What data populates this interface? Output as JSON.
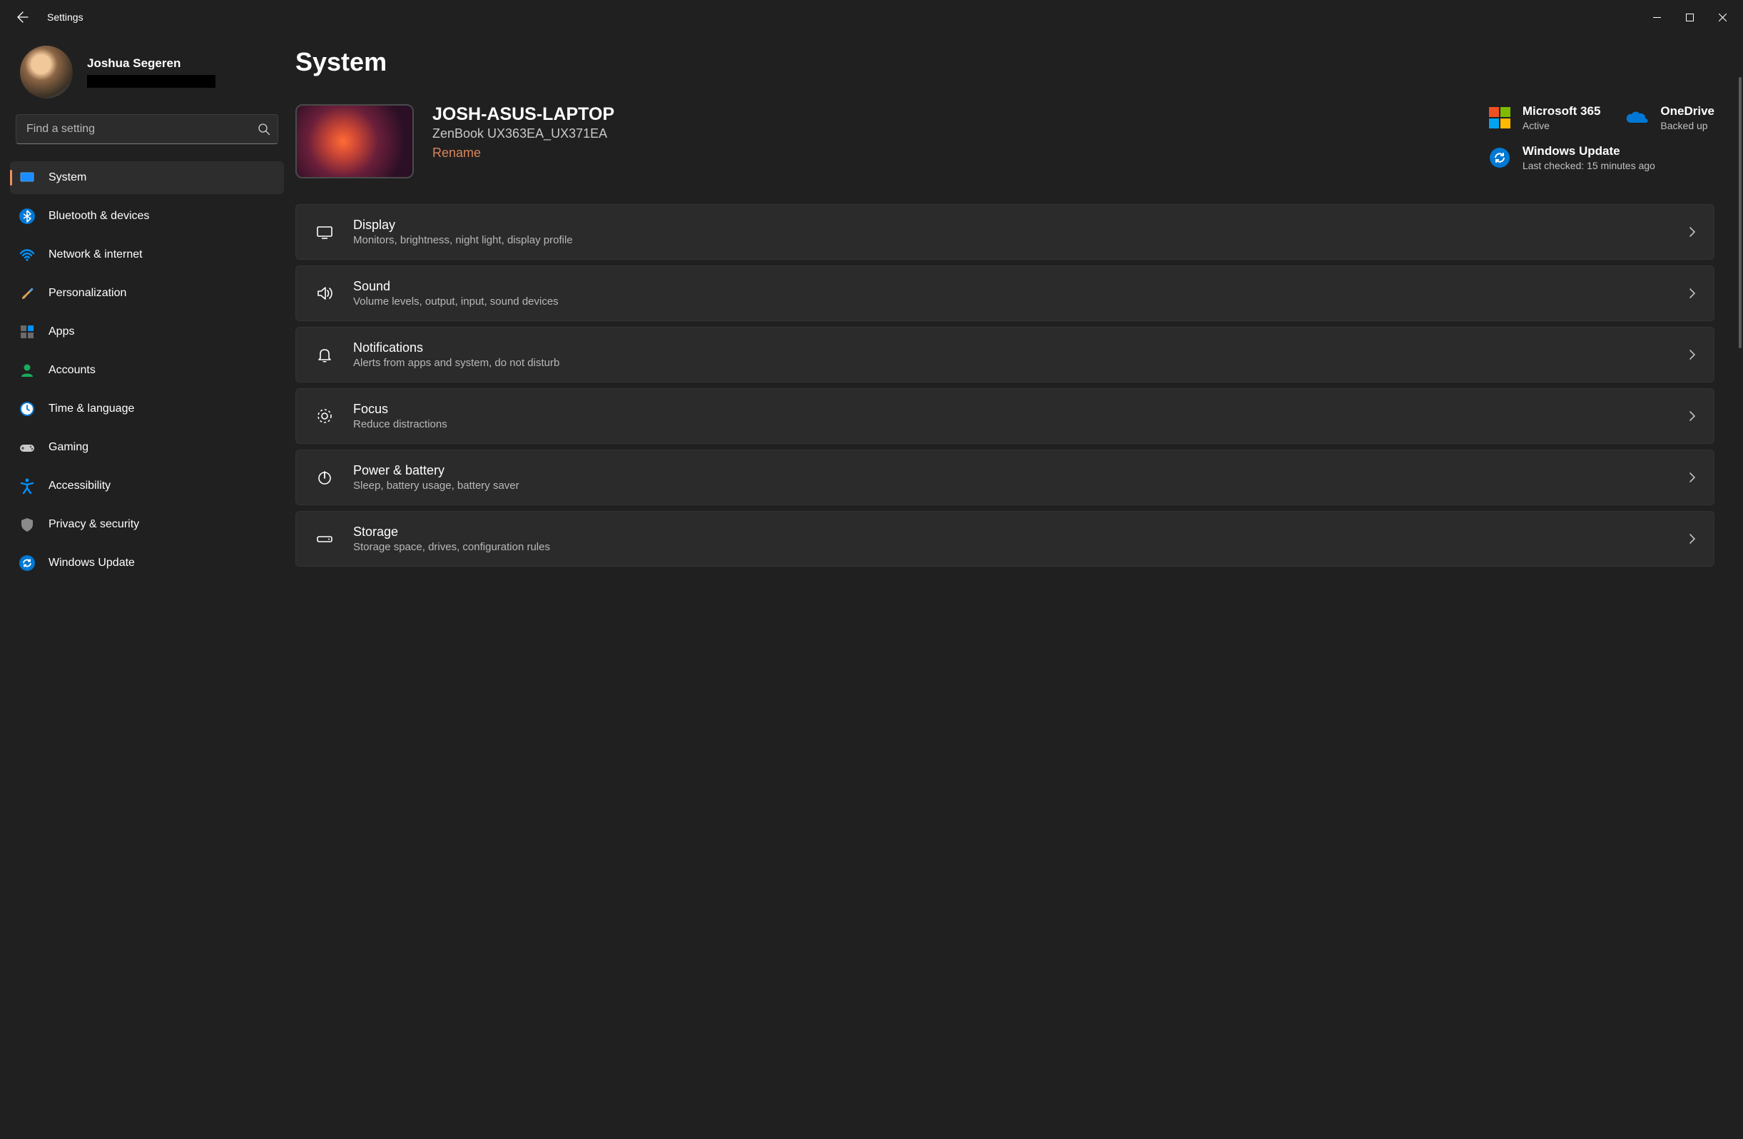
{
  "app_title": "Settings",
  "page_title": "System",
  "profile": {
    "name": "Joshua Segeren"
  },
  "search": {
    "placeholder": "Find a setting"
  },
  "sidebar": {
    "items": [
      {
        "label": "System",
        "icon": "system"
      },
      {
        "label": "Bluetooth & devices",
        "icon": "bluetooth"
      },
      {
        "label": "Network & internet",
        "icon": "wifi"
      },
      {
        "label": "Personalization",
        "icon": "brush"
      },
      {
        "label": "Apps",
        "icon": "apps"
      },
      {
        "label": "Accounts",
        "icon": "person"
      },
      {
        "label": "Time & language",
        "icon": "time"
      },
      {
        "label": "Gaming",
        "icon": "gamepad"
      },
      {
        "label": "Accessibility",
        "icon": "accessibility"
      },
      {
        "label": "Privacy & security",
        "icon": "shield"
      },
      {
        "label": "Windows Update",
        "icon": "update"
      }
    ],
    "active_index": 0
  },
  "device": {
    "name": "JOSH-ASUS-LAPTOP",
    "model": "ZenBook UX363EA_UX371EA",
    "rename_label": "Rename"
  },
  "status": {
    "m365": {
      "title": "Microsoft 365",
      "subtitle": "Active"
    },
    "onedrive": {
      "title": "OneDrive",
      "subtitle": "Backed up"
    },
    "update": {
      "title": "Windows Update",
      "subtitle": "Last checked: 15 minutes ago"
    }
  },
  "settings": [
    {
      "title": "Display",
      "desc": "Monitors, brightness, night light, display profile",
      "icon": "display"
    },
    {
      "title": "Sound",
      "desc": "Volume levels, output, input, sound devices",
      "icon": "sound"
    },
    {
      "title": "Notifications",
      "desc": "Alerts from apps and system, do not disturb",
      "icon": "bell"
    },
    {
      "title": "Focus",
      "desc": "Reduce distractions",
      "icon": "focus"
    },
    {
      "title": "Power & battery",
      "desc": "Sleep, battery usage, battery saver",
      "icon": "power"
    },
    {
      "title": "Storage",
      "desc": "Storage space, drives, configuration rules",
      "icon": "storage"
    }
  ]
}
